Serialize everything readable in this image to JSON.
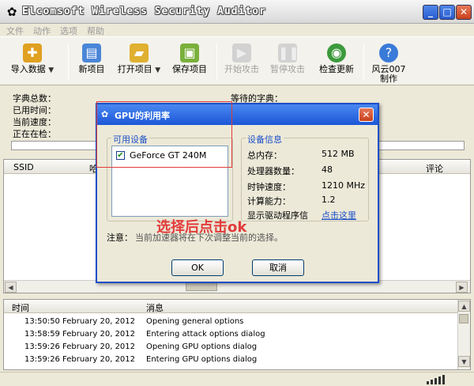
{
  "window": {
    "title": "Elcomsoft Wireless Security Auditor"
  },
  "menu": [
    "文件",
    "动作",
    "选项",
    "帮助"
  ],
  "toolbar": {
    "import": "导入数据",
    "new_project": "新项目",
    "open_project": "打开项目",
    "save_project": "保存项目",
    "start_attack": "开始攻击",
    "pause_attack": "暂停攻击",
    "check_update": "检查更新",
    "wifi_sniffer_line1": "风云007",
    "wifi_sniffer_line2": "制作"
  },
  "info": {
    "dict_total": "字典总数：",
    "elapsed": "已用时间：",
    "current_speed": "当前速度：",
    "processing": "正在在检：",
    "waiting_dict": "等待的字典："
  },
  "table": {
    "col_ssid": "SSID",
    "col_bssid": "哈",
    "col_rating": "评论"
  },
  "log": {
    "col_time": "时间",
    "col_message": "消息",
    "rows": [
      {
        "time": "13:50:50",
        "date": "February 20, 2012",
        "msg": "Opening general options"
      },
      {
        "time": "13:58:59",
        "date": "February 20, 2012",
        "msg": "Entering attack options dialog"
      },
      {
        "time": "13:59:26",
        "date": "February 20, 2012",
        "msg": "Opening GPU options dialog"
      },
      {
        "time": "13:59:26",
        "date": "February 20, 2012",
        "msg": "Entering GPU options dialog"
      }
    ]
  },
  "dialog": {
    "title": "GPU的利用率",
    "available_devices": "可用设备",
    "device_name": "GeForce GT 240M",
    "device_info": "设备信息",
    "total_memory_label": "总内存：",
    "total_memory_value": "512 MB",
    "processors_label": "处理器数量：",
    "processors_value": "48",
    "clock_label": "时钟速度：",
    "clock_value": "1210 MHz",
    "compute_label": "计算能力：",
    "compute_value": "1.2",
    "driver_label": "显示驱动程序信",
    "driver_link": "点击这里",
    "note": "注意：",
    "note_text": "当前加速器将在下次调整当前的选择。",
    "ok": "OK",
    "cancel": "取消"
  },
  "annotation": "选择后点击ok",
  "colors": {
    "title_blue": "#1c56d8",
    "annotation_red": "#e23b3b"
  }
}
